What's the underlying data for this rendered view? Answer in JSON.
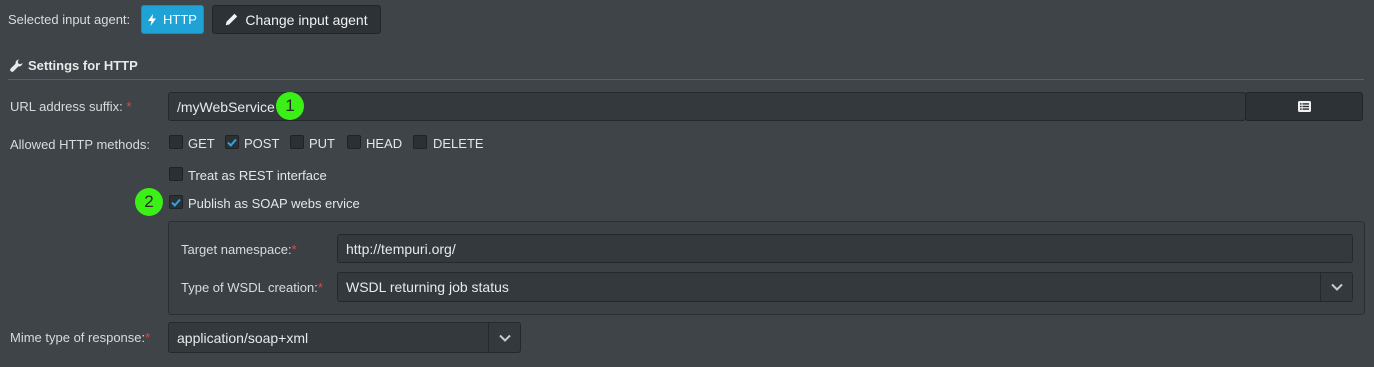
{
  "header": {
    "selected_agent_label": "Selected input agent:",
    "http_button_label": "HTTP",
    "change_agent_button_label": "Change input agent"
  },
  "section": {
    "title": "Settings for HTTP"
  },
  "url_suffix": {
    "label": "URL address suffix:",
    "required_mark": "*",
    "value": "/myWebService"
  },
  "methods": {
    "label": "Allowed HTTP methods:",
    "options": [
      {
        "label": "GET",
        "checked": false
      },
      {
        "label": "POST",
        "checked": true
      },
      {
        "label": "PUT",
        "checked": false
      },
      {
        "label": "HEAD",
        "checked": false
      },
      {
        "label": "DELETE",
        "checked": false
      }
    ]
  },
  "rest": {
    "label": "Treat as REST interface",
    "checked": false
  },
  "soap": {
    "label": "Publish as SOAP webs ervice",
    "checked": true,
    "namespace_label": "Target namespace:",
    "namespace_value": "http://tempuri.org/",
    "wsdl_label": "Type of WSDL creation:",
    "wsdl_value": "WSDL returning job status"
  },
  "mime": {
    "label": "Mime type of response:",
    "value": "application/soap+xml"
  },
  "markers": [
    "1",
    "2"
  ],
  "colors": {
    "background": "#3e4447",
    "accent_blue": "#1fa3d6",
    "required_red": "#e04848",
    "marker_green": "#3af016",
    "check_blue": "#36a3e0"
  },
  "icons": {
    "http_button": "lightning-icon",
    "change_button": "pencil-icon",
    "section": "wrench-icon",
    "list_button": "list-icon",
    "dropdown": "chevron-down-icon"
  }
}
